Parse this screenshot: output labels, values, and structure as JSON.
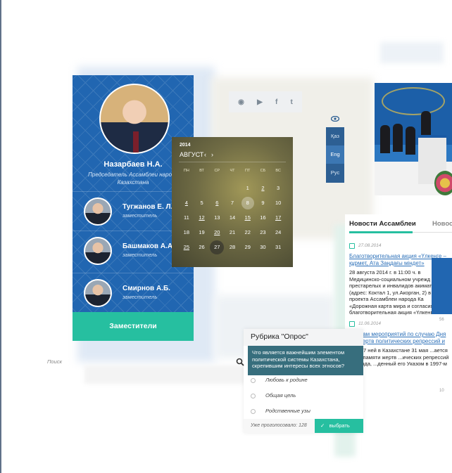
{
  "chairman": {
    "name": "Назарбаев Н.А.",
    "role": "Председатель Ассамблеи народа Казахстана"
  },
  "deputies": [
    {
      "name": "Тугжанов Е. Л.",
      "role": "заместитель"
    },
    {
      "name": "Башмаков А.А.",
      "role": "заместитель"
    },
    {
      "name": "Смирнов А.Б.",
      "role": "заместитель"
    }
  ],
  "deputies_button": "Заместители",
  "calendar": {
    "year": "2014",
    "month": "АВГУСТ",
    "prev": "‹",
    "next": "›",
    "weekdays": [
      "ПН",
      "ВТ",
      "СР",
      "ЧТ",
      "ПТ",
      "СБ",
      "ВС"
    ],
    "days": [
      "",
      "",
      "",
      "",
      "1",
      "2",
      "3",
      "4",
      "5",
      "6",
      "7",
      "8",
      "9",
      "10",
      "11",
      "12",
      "13",
      "14",
      "15",
      "16",
      "17",
      "18",
      "19",
      "20",
      "21",
      "22",
      "23",
      "24",
      "25",
      "26",
      "27",
      "28",
      "29",
      "30",
      "31"
    ],
    "underlined": [
      "2",
      "4",
      "6",
      "12",
      "15",
      "17",
      "20",
      "25"
    ],
    "selected": "8",
    "today": "27"
  },
  "social": {
    "rss": "rss-icon",
    "youtube": "youtube-icon",
    "facebook": "facebook-icon",
    "twitter": "twitter-icon",
    "labels": [
      "◉",
      "▶",
      "f",
      "t"
    ]
  },
  "languages": [
    "Қаз",
    "Eng",
    "Рус"
  ],
  "active_language": "Eng",
  "news": {
    "tab_active": "Новости Ассамблеи",
    "tab_other": "Новос",
    "items": [
      {
        "date": "27.08.2014",
        "title": "Благотворительная акция «Үлкенге – құрмет, Ата Заңдағы міндет»",
        "text": "28 августа 2014 г. в 11:00 ч. в Медицинско-социальном учрежд престарелых и инвалидов акимата (адрес: Коктал 1, ул.Акорган, 2) в мега-проекта Ассамблеи народа Ка «Дорожная карта мира и согласия» благотворительная акция «Үлкенге"
      },
      {
        "date": "11.06.2014",
        "title": "...никам мероприятий по случаю Дня ...и жертв политических репрессий и",
        "text": "...ке 17 ней в Казахстане 31 мая ...ается День памяти жертв ...ических репрессий и голода, ...денный его Указом в 1997-м году"
      }
    ],
    "views": [
      "56",
      "10"
    ]
  },
  "poll": {
    "title": "Рубрика \"Опрос\"",
    "question": "Что является важнейшим элементом политической системы Казахстана, скрепившим интересы всех этносов?",
    "options": [
      "Любовь к родине",
      "Общая цель",
      "Родственные узы"
    ],
    "voted": "Уже проголосовало: 128",
    "button": "выбрать"
  },
  "search": {
    "label": "Поиск"
  },
  "colors": {
    "primary": "#2166b1",
    "accent": "#26bfa0",
    "poll_question": "#376e7d"
  }
}
